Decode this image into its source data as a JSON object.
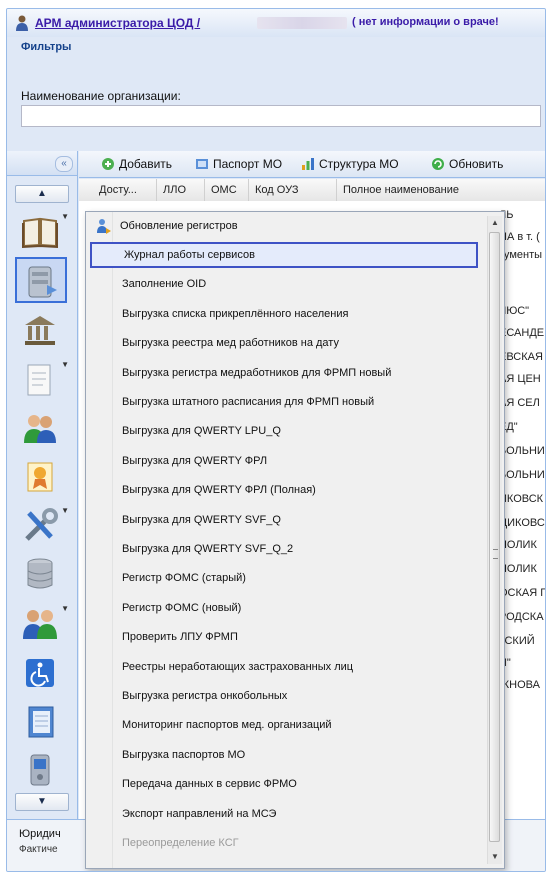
{
  "titlebar": {
    "title": "АРМ администратора ЦОД /",
    "no_doctor": "( нет информации о враче!"
  },
  "filters": {
    "title": "Фильтры",
    "org_label": "Наименование организации:",
    "org_value": ""
  },
  "leftcol": {
    "collapse_glyph": "«",
    "scroll_up_glyph": "▲",
    "scroll_down_glyph": "▼"
  },
  "toolbar": {
    "add": "Добавить",
    "passport": "Паспорт МО",
    "structure": "Структура МО",
    "refresh": "Обновить"
  },
  "grid": {
    "columns": [
      "Досту...",
      "ЛЛО",
      "ОМС",
      "Код ОУЗ",
      "Полное наименование"
    ],
    "partial_rows": [
      "ЛЬ",
      "НА в т. ( ",
      "кументы",
      "ЛЮС\"",
      "ЕСАНДЕ",
      "ЕВСКАЯ",
      "АЯ ЦЕН",
      "АЯ СЕЛ",
      "ЕД\"",
      "БОЛЬНИ",
      "БОЛЬНИ",
      "ИКОВСК",
      "ЦИКОВСН",
      "ПОЛИК",
      "ПОЛИК",
      "ОСКАЯ Г",
      "РОДСКА",
      "ГСКИЙ",
      "И\"",
      "ЖНОВА"
    ]
  },
  "menu": {
    "header": "Обновление регистров",
    "items": [
      {
        "label": "Журнал работы сервисов",
        "selected": true,
        "disabled": false
      },
      {
        "label": "Заполнение OID",
        "selected": false,
        "disabled": false
      },
      {
        "label": "Выгрузка списка прикреплённого населения",
        "selected": false,
        "disabled": false
      },
      {
        "label": "Выгрузка реестра мед работников на дату",
        "selected": false,
        "disabled": false
      },
      {
        "label": "Выгрузка регистра медработников для ФРМП новый",
        "selected": false,
        "disabled": false
      },
      {
        "label": "Выгрузка штатного расписания для ФРМП новый",
        "selected": false,
        "disabled": false
      },
      {
        "label": "Выгрузка для QWERTY LPU_Q",
        "selected": false,
        "disabled": false
      },
      {
        "label": "Выгрузка для QWERTY ФРЛ",
        "selected": false,
        "disabled": false
      },
      {
        "label": "Выгрузка для QWERTY ФРЛ (Полная)",
        "selected": false,
        "disabled": false
      },
      {
        "label": "Выгрузка для QWERTY SVF_Q",
        "selected": false,
        "disabled": false
      },
      {
        "label": "Выгрузка для QWERTY SVF_Q_2",
        "selected": false,
        "disabled": false
      },
      {
        "label": "Регистр ФОМС (старый)",
        "selected": false,
        "disabled": false
      },
      {
        "label": "Регистр ФОМС (новый)",
        "selected": false,
        "disabled": false
      },
      {
        "label": "Проверить ЛПУ ФРМП",
        "selected": false,
        "disabled": false
      },
      {
        "label": "Реестры неработающих застрахованных лиц",
        "selected": false,
        "disabled": false
      },
      {
        "label": "Выгрузка регистра онкобольных",
        "selected": false,
        "disabled": false
      },
      {
        "label": "Мониторинг паспортов мед. организаций",
        "selected": false,
        "disabled": false
      },
      {
        "label": "Выгрузка паспортов МО",
        "selected": false,
        "disabled": false
      },
      {
        "label": "Передача данных в сервис ФРМО",
        "selected": false,
        "disabled": false
      },
      {
        "label": "Экспорт направлений на МСЭ",
        "selected": false,
        "disabled": false
      },
      {
        "label": "Переопределение КСГ",
        "selected": false,
        "disabled": true
      }
    ]
  },
  "bottom": {
    "line1": "Юридич",
    "line2": "Фактиче"
  },
  "colors": {
    "selection_border": "#3e52c5",
    "panel_bg": "#dfe8f6",
    "link": "#3a1ba8"
  }
}
